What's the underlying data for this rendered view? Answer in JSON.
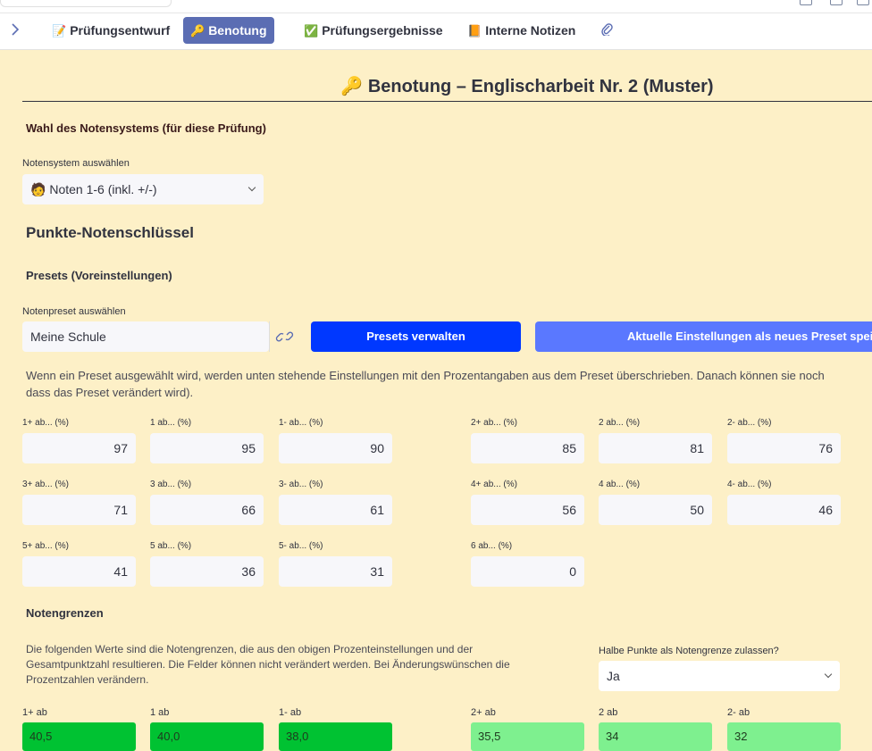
{
  "tabs": [
    {
      "icon": "📝",
      "label": "Prüfungsentwurf",
      "active": false
    },
    {
      "icon": "🔑",
      "label": "Benotung",
      "active": true
    },
    {
      "icon": "✅",
      "label": "Prüfungsergebnisse",
      "active": false
    },
    {
      "icon": "📙",
      "label": "Interne Notizen",
      "active": false
    }
  ],
  "page_title": "🔑 Benotung – Englischarbeit Nr. 2 (Muster)",
  "system": {
    "heading": "Wahl des Notensystems (für diese Prüfung)",
    "select_label": "Notensystem auswählen",
    "selected_icon": "🧑",
    "selected": "Noten 1-6 (inkl. +/-)"
  },
  "key_heading": "Punkte-Notenschlüssel",
  "presets": {
    "heading": "Presets (Voreinstellungen)",
    "select_label": "Notenpreset auswählen",
    "selected": "Meine Schule",
    "manage_button": "Presets verwalten",
    "save_button": "Aktuelle Einstellungen als neues Preset speichern",
    "note_line1": "Wenn ein Preset ausgewählt wird, werden unten stehende Einstellungen mit den Prozentangaben aus dem Preset überschrieben. Danach können sie noch",
    "note_line2": "dass das Preset verändert wird)."
  },
  "percent_fields": [
    {
      "label": "1+ ab... (%)",
      "value": "97"
    },
    {
      "label": "1 ab... (%)",
      "value": "95"
    },
    {
      "label": "1- ab... (%)",
      "value": "90"
    },
    {
      "label": "2+ ab... (%)",
      "value": "85"
    },
    {
      "label": "2 ab... (%)",
      "value": "81"
    },
    {
      "label": "2- ab... (%)",
      "value": "76"
    },
    {
      "label": "3+ ab... (%)",
      "value": "71"
    },
    {
      "label": "3 ab... (%)",
      "value": "66"
    },
    {
      "label": "3- ab... (%)",
      "value": "61"
    },
    {
      "label": "4+ ab... (%)",
      "value": "56"
    },
    {
      "label": "4 ab... (%)",
      "value": "50"
    },
    {
      "label": "4- ab... (%)",
      "value": "46"
    },
    {
      "label": "5+ ab... (%)",
      "value": "41"
    },
    {
      "label": "5 ab... (%)",
      "value": "36"
    },
    {
      "label": "5- ab... (%)",
      "value": "31"
    },
    {
      "label": "6 ab... (%)",
      "value": "0"
    }
  ],
  "boundaries": {
    "heading": "Notengrenzen",
    "text_line1": "Die folgenden Werte sind die Notengrenzen, die aus den obigen Prozenteinstellungen und der",
    "text_line2": "Gesamtpunktzahl resultieren. Die Felder können nicht verändert werden. Bei Änderungswünschen die",
    "text_line3": "Prozentzahlen verändern.",
    "half_points_label": "Halbe Punkte als Notengrenze zulassen?",
    "half_points_value": "Ja",
    "items": [
      {
        "label": "1+ ab",
        "value": "40,5"
      },
      {
        "label": "1 ab",
        "value": "40,0"
      },
      {
        "label": "1- ab",
        "value": "38,0"
      },
      {
        "label": "2+ ab",
        "value": "35,5"
      },
      {
        "label": "2 ab",
        "value": "34"
      },
      {
        "label": "2- ab",
        "value": "32"
      }
    ]
  },
  "colors": {
    "tab_active": "#5b6db3",
    "content_bg": "#fdf0c7",
    "button_primary": "#0038ff",
    "button_secondary": "#5a78ff",
    "grade1_band": "#00c232",
    "grade2_band": "#7ef08f"
  }
}
